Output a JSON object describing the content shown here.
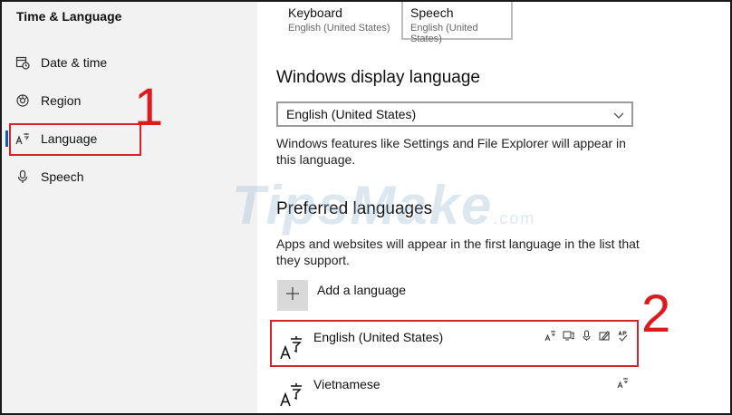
{
  "sidebar": {
    "title": "Time & Language",
    "items": [
      {
        "label": "Date & time",
        "icon": "calendar-clock-icon"
      },
      {
        "label": "Region",
        "icon": "globe-icon"
      },
      {
        "label": "Language",
        "icon": "language-icon",
        "active": true
      },
      {
        "label": "Speech",
        "icon": "microphone-icon"
      }
    ]
  },
  "tabs": [
    {
      "name": "Keyboard",
      "sub": "English (United States)"
    },
    {
      "name": "Speech",
      "sub": "English (United States)",
      "selected": true
    }
  ],
  "display_language": {
    "title": "Windows display language",
    "selected": "English (United States)",
    "description": "Windows features like Settings and File Explorer will appear in this language."
  },
  "preferred": {
    "title": "Preferred languages",
    "description": "Apps and websites will appear in the first language in the list that they support.",
    "add_label": "Add a language",
    "languages": [
      {
        "name": "English (United States)",
        "features": [
          "display-language-icon",
          "text-to-speech-icon",
          "speech-recognition-icon",
          "handwriting-icon",
          "spell-check-icon"
        ]
      },
      {
        "name": "Vietnamese",
        "features": [
          "display-language-icon"
        ]
      }
    ]
  },
  "annotations": {
    "first": "1",
    "second": "2"
  },
  "watermark": {
    "brand": "TipsMake",
    "suffix": ".com"
  },
  "colors": {
    "accent": "#0063b1",
    "annotation": "#e0191f",
    "sidebar_bg": "#f2f2f2"
  }
}
